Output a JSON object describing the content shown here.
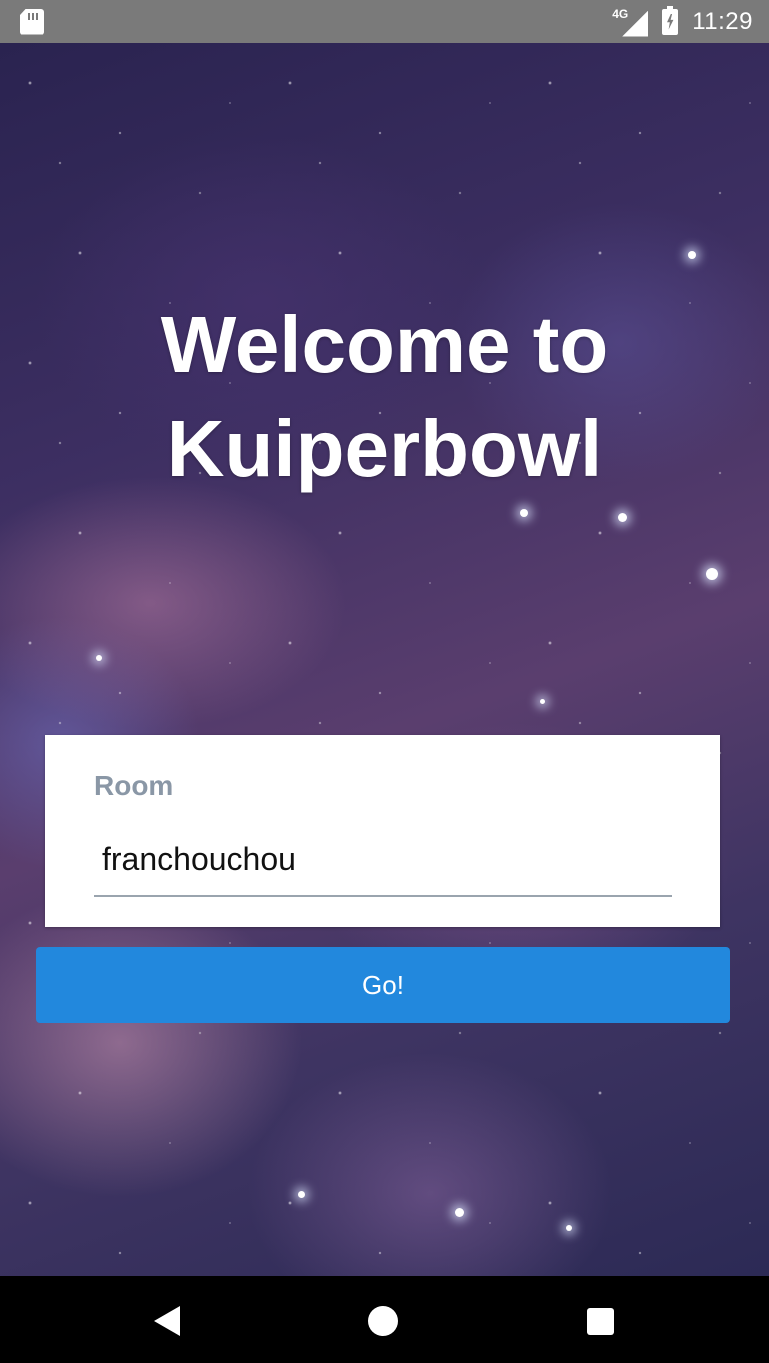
{
  "status_bar": {
    "network_type": "4G",
    "time": "11:29",
    "icons": [
      "sd-card-icon",
      "signal-icon",
      "battery-charging-icon"
    ]
  },
  "welcome": {
    "line1": "Welcome to",
    "line2": "Kuiperbowl"
  },
  "room_form": {
    "label": "Room",
    "value": "franchouchou"
  },
  "go_button": {
    "label": "Go!"
  },
  "nav_bar": {
    "icons": [
      "back-icon",
      "home-icon",
      "recents-icon"
    ]
  },
  "colors": {
    "status_bar_bg": "#7a7a7a",
    "button_bg": "#2288dd",
    "label_color": "#8a97a6",
    "nav_bar_bg": "#000000"
  }
}
